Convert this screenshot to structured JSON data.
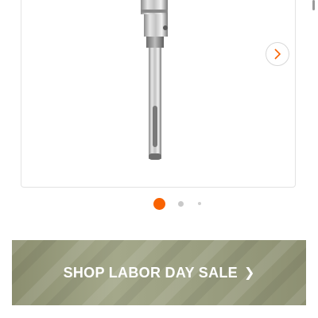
{
  "product_carousel": {
    "product_image": "hammer-drill-core-bit-adapter",
    "next_icon": "chevron-right-icon",
    "pagination": {
      "total": 3,
      "active_index": 0
    },
    "accent_color": "#f96302"
  },
  "promo_banner": {
    "label": "SHOP LABOR DAY SALE",
    "chevron": "❯",
    "background_color": "#9a9e80"
  }
}
